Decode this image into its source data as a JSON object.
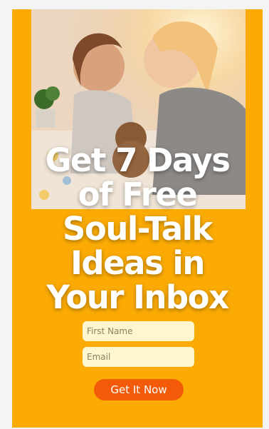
{
  "hero": {
    "headline_lines": [
      "Get 7 Days",
      "of Free",
      "Soul-Talk",
      "Ideas in",
      "Your Inbox"
    ]
  },
  "form": {
    "first_name_placeholder": "First Name",
    "email_placeholder": "Email",
    "submit_label": "Get It Now"
  },
  "colors": {
    "card_background": "#fbab04",
    "input_background": "#fdf7cf",
    "button_background": "#f45b09"
  }
}
